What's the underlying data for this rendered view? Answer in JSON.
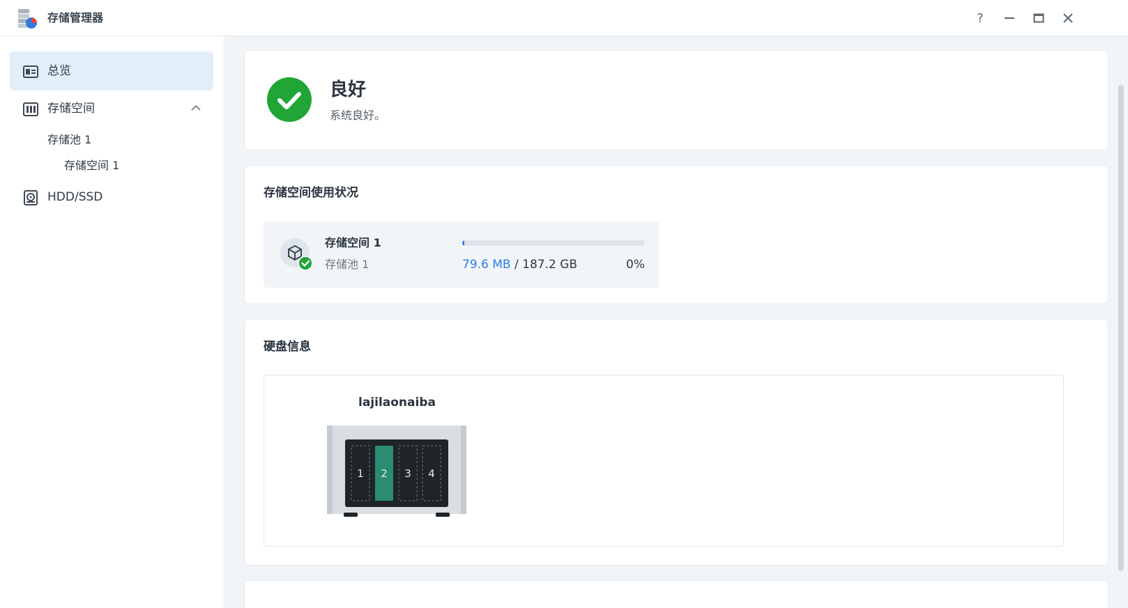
{
  "window": {
    "title": "存储管理器",
    "controls": {
      "help": "?",
      "minimize": "—",
      "maximize": "□",
      "close": "✕"
    }
  },
  "sidebar": {
    "items": [
      {
        "label": "总览",
        "icon": "overview-icon",
        "active": true
      },
      {
        "label": "存储空间",
        "icon": "storage-icon",
        "expanded": true
      },
      {
        "label": "HDD/SSD",
        "icon": "hdd-icon"
      }
    ],
    "subitems": {
      "pool": "存储池 1",
      "volume": "存储空间 1"
    }
  },
  "status": {
    "title": "良好",
    "description": "系统良好。",
    "color": "#21a537"
  },
  "volume_usage": {
    "section_title": "存储空间使用状况",
    "volume_name": "存储空间 1",
    "pool_name": "存储池 1",
    "used": "79.6 MB",
    "separator": " / ",
    "total": "187.2 GB",
    "percent": "0%",
    "fill_fraction": 0.004
  },
  "disk_info": {
    "section_title": "硬盘信息",
    "device_name": "lajilaonaiba",
    "bays": [
      "1",
      "2",
      "3",
      "4"
    ],
    "occupied_bay": "2"
  },
  "colors": {
    "accent": "#2f7de0",
    "status_good": "#21a537",
    "drive_active": "#2a8c73"
  }
}
